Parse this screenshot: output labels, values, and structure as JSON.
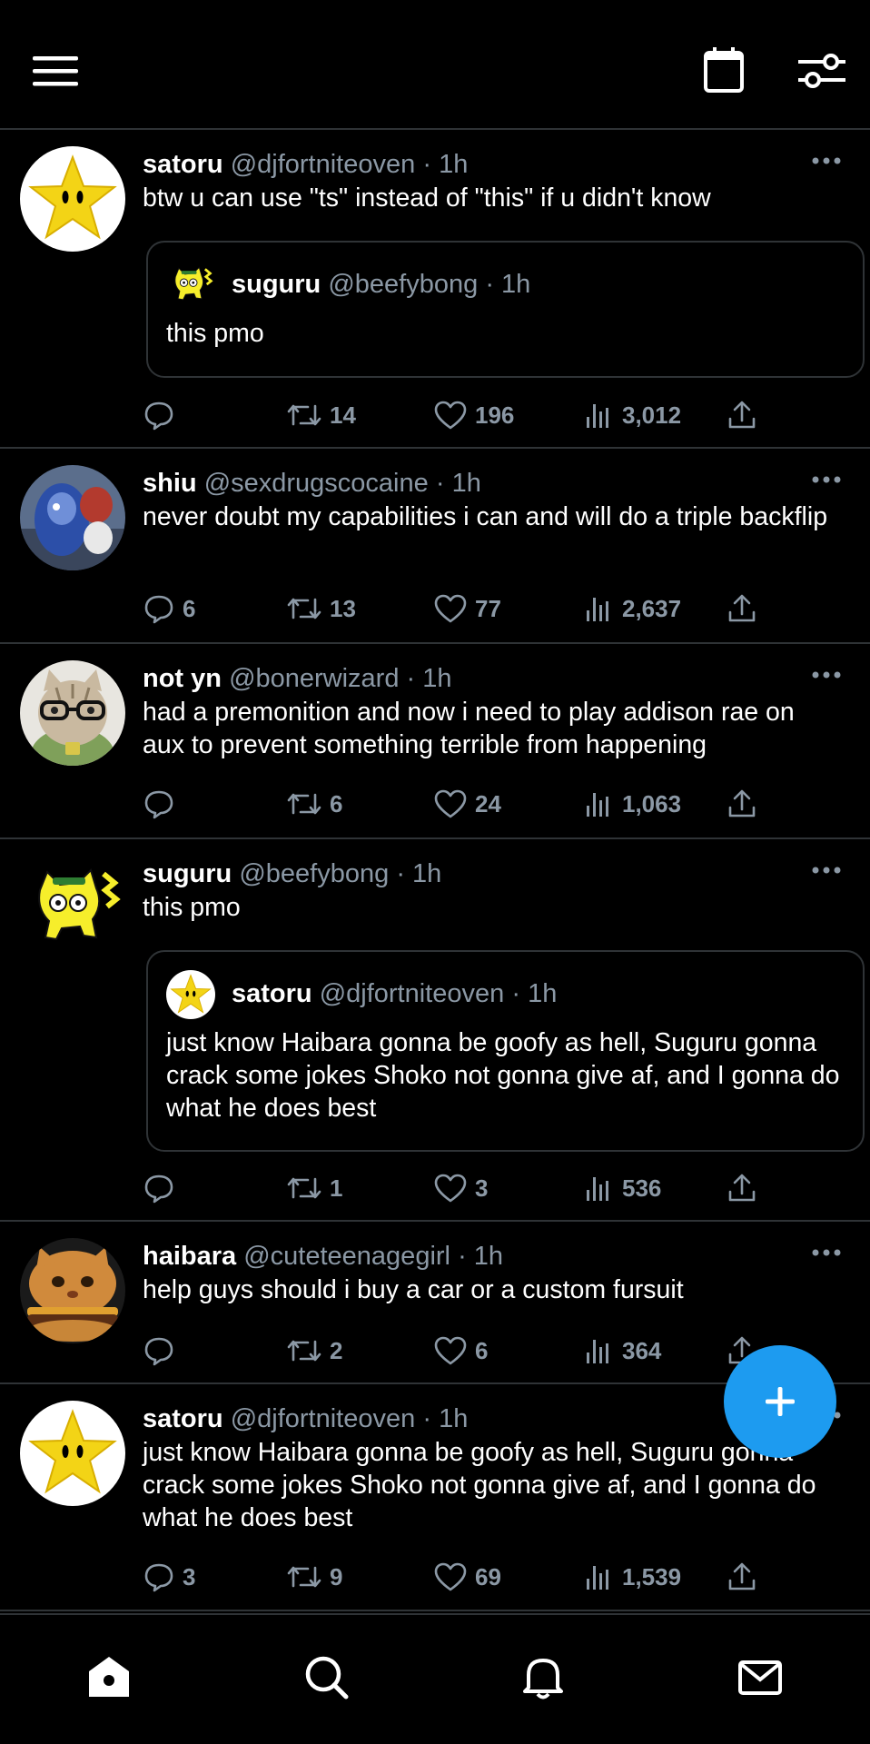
{
  "header": {
    "menu_icon": "hamburger-menu-icon",
    "calendar_icon": "calendar-icon",
    "settings_icon": "sliders-settings-icon"
  },
  "posts": [
    {
      "avatar": "star-avatar",
      "name": "satoru",
      "handle": "@djfortniteoven",
      "sep": "·",
      "time": "1h",
      "text": "btw u can use \"ts\" instead of \"this\" if u didn't know",
      "quote": {
        "avatar": "yellow-cat-avatar",
        "name": "suguru",
        "handle": "@beefybong",
        "sep": "·",
        "time": "1h",
        "text": "this pmo"
      },
      "replies": "",
      "reposts": "14",
      "likes": "196",
      "views": "3,012"
    },
    {
      "avatar": "robot-figures-avatar",
      "name": "shiu",
      "handle": "@sexdrugscocaine",
      "sep": "·",
      "time": "1h",
      "text": "never doubt my capabilities i can and will do a triple backflip",
      "replies": "6",
      "reposts": "13",
      "likes": "77",
      "views": "2,637"
    },
    {
      "avatar": "cat-glasses-avatar",
      "name": "not yn",
      "handle": "@bonerwizard",
      "sep": "·",
      "time": "1h",
      "text": "had a premonition and now i need to play addison rae on aux to prevent something terrible from happening",
      "replies": "",
      "reposts": "6",
      "likes": "24",
      "views": "1,063"
    },
    {
      "avatar": "yellow-cat-avatar",
      "name": "suguru",
      "handle": "@beefybong",
      "sep": "·",
      "time": "1h",
      "text": "this pmo",
      "quote": {
        "avatar": "star-avatar",
        "name": "satoru",
        "handle": "@djfortniteoven",
        "sep": "·",
        "time": "1h",
        "text": "just know Haibara gonna be goofy as hell, Suguru gonna crack some jokes Shoko not gonna give af, and I gonna do what he does best"
      },
      "replies": "",
      "reposts": "1",
      "likes": "3",
      "views": "536"
    },
    {
      "avatar": "cat-burger-avatar",
      "name": "haibara",
      "handle": "@cuteteenagegirl",
      "sep": "·",
      "time": "1h",
      "text": "help guys should i buy a car or a custom fursuit",
      "replies": "",
      "reposts": "2",
      "likes": "6",
      "views": "364"
    },
    {
      "avatar": "star-avatar",
      "name": "satoru",
      "handle": "@djfortniteoven",
      "sep": "·",
      "time": "1h",
      "text": "just know Haibara gonna be goofy as hell, Suguru gonna crack some jokes Shoko not gonna give af, and I gonna do what he does best",
      "replies": "3",
      "reposts": "9",
      "likes": "69",
      "views": "1,539"
    }
  ],
  "fab": {
    "icon": "plus-icon"
  },
  "tabbar": {
    "items": [
      "home-icon",
      "search-icon",
      "bell-icon",
      "mail-icon"
    ]
  },
  "colors": {
    "background": "#000000",
    "accent": "#1d9bf0",
    "divider": "#2f3336",
    "muted": "#8b98a5"
  }
}
